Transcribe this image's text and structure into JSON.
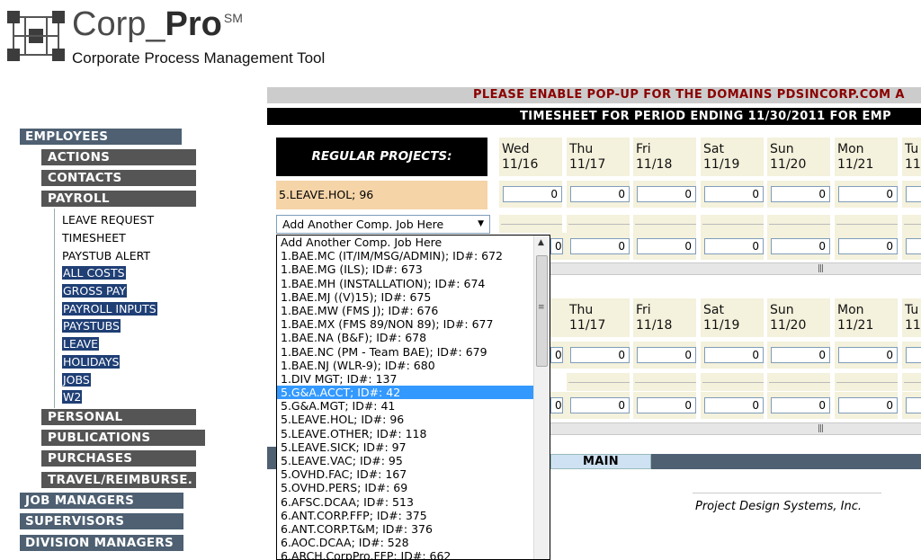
{
  "brand": {
    "title_main": "Corp_",
    "title_bold": "Pro",
    "title_mark": "SM",
    "subtitle": "Corporate Process Management Tool"
  },
  "nav": {
    "employees": "EMPLOYEES",
    "actions": "ACTIONS",
    "contacts": "CONTACTS",
    "payroll": "PAYROLL",
    "payroll_links": [
      {
        "label": "LEAVE REQUEST"
      },
      {
        "label": "TIMESHEET"
      },
      {
        "label": "PAYSTUB ALERT"
      },
      {
        "label": "ALL COSTS"
      },
      {
        "label": "GROSS PAY"
      },
      {
        "label": "PAYROLL INPUTS"
      },
      {
        "label": "PAYSTUBS"
      },
      {
        "label": "LEAVE"
      },
      {
        "label": "HOLIDAYS"
      },
      {
        "label": "JOBS"
      },
      {
        "label": "W2"
      }
    ],
    "personal": "PERSONAL",
    "publications": "PUBLICATIONS",
    "purchases": "PURCHASES",
    "travel": "TRAVEL/REIMBURSE.",
    "job_managers": "JOB MANAGERS",
    "supervisors": "SUPERVISORS",
    "division_managers": "DIVISION MANAGERS"
  },
  "banners": {
    "popup": "PLEASE ENABLE POP-UP FOR THE DOMAINS PDSINCORP.COM A",
    "period": "TIMESHEET FOR PERIOD ENDING 11/30/2011  FOR EMP"
  },
  "timesheet": {
    "regular_label": "REGULAR PROJECTS:",
    "days_top": [
      {
        "day": "Wed",
        "date": "11/16"
      },
      {
        "day": "Thu",
        "date": "11/17"
      },
      {
        "day": "Fri",
        "date": "11/18"
      },
      {
        "day": "Sat",
        "date": "11/19"
      },
      {
        "day": "Sun",
        "date": "11/20"
      },
      {
        "day": "Mon",
        "date": "11/21"
      },
      {
        "day": "Tu",
        "date": "11/"
      }
    ],
    "days_bottom": [
      {
        "day": "Thu",
        "date": "11/17"
      },
      {
        "day": "Fri",
        "date": "11/18"
      },
      {
        "day": "Sat",
        "date": "11/19"
      },
      {
        "day": "Sun",
        "date": "11/20"
      },
      {
        "day": "Mon",
        "date": "11/21"
      },
      {
        "day": "Tu",
        "date": "11/"
      }
    ],
    "job_row_label": "5.LEAVE.HOL; 96",
    "hour_value": "0",
    "add_job_placeholder": "Add Another Comp. Job Here",
    "main_button": "MAIN"
  },
  "dropdown": {
    "selected_index": 10,
    "options": [
      "Add Another Comp. Job Here",
      "1.BAE.MC (IT/IM/MSG/ADMIN); ID#: 672",
      "1.BAE.MG (ILS); ID#: 673",
      "1.BAE.MH (INSTALLATION); ID#: 674",
      "1.BAE.MJ ((V)15); ID#: 675",
      "1.BAE.MW (FMS J); ID#: 676",
      "1.BAE.MX (FMS 89/NON 89); ID#: 677",
      "1.BAE.NA (B&F); ID#: 678",
      "1.BAE.NC (PM - Team BAE); ID#: 679",
      "1.BAE.NJ (WLR-9); ID#: 680",
      "1.DIV MGT; ID#: 137",
      "5.G&A.ACCT; ID#: 42",
      "5.G&A.MGT; ID#: 41",
      "5.LEAVE.HOL; ID#: 96",
      "5.LEAVE.OTHER; ID#: 118",
      "5.LEAVE.SICK; ID#: 97",
      "5.LEAVE.VAC; ID#: 95",
      "5.OVHD.FAC; ID#: 167",
      "5.OVHD.PERS; ID#: 69",
      "6.AFSC.DCAA; ID#: 513",
      "6.ANT.CORP.FFP; ID#: 375",
      "6.ANT.CORP.T&M; ID#: 376",
      "6.AOC.DCAA; ID#: 528",
      "6.ARCH.CorpPro.FFP; ID#: 662"
    ]
  },
  "footer": {
    "company": "Project Design Systems, Inc."
  },
  "colors": {
    "nav_main": "#4e6072",
    "nav_sub": "#555555",
    "nav_selected": "#1f3f75",
    "day_header": "#f4f1dc",
    "job_label": "#f5d4a8",
    "popup_text": "#8b0000",
    "dropdown_selected": "#3399ff"
  }
}
